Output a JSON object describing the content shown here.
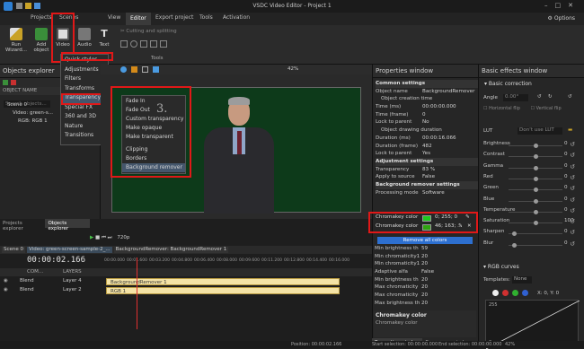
{
  "window_title": "VSDC Video Editor - Project 1",
  "menu": [
    "Projects",
    "Scenes",
    "View",
    "Editor",
    "Export project",
    "Tools",
    "Activation"
  ],
  "options_label": "Options",
  "ribbon": {
    "buttons": [
      "Run Wizard...",
      "Add object",
      "Video",
      "Audio",
      "Text"
    ],
    "cutting": "Cutting and splitting",
    "tools_label": "Tools"
  },
  "objects_explorer": {
    "title": "Objects explorer",
    "object_name_col": "OBJECT NAME",
    "search_placeholder": "Search objects...",
    "tree": [
      "Scene 0",
      "Video: green-s...",
      "RGB: RGB 1"
    ]
  },
  "video_menu": [
    "Quick styles",
    "Adjustments",
    "Filters",
    "Transforms",
    "Transparency",
    "Special FX",
    "360 and 3D",
    "Nature",
    "Transitions"
  ],
  "transparency_menu": [
    "Fade In",
    "Fade Out",
    "Custom transparency",
    "Make opaque",
    "Make transparent",
    "Clipping",
    "Borders",
    "Background remover"
  ],
  "step_label": "3.",
  "preview_zoom": "42%",
  "properties": {
    "title": "Properties window",
    "rows": [
      {
        "type": "section",
        "label": "Common settings"
      },
      {
        "label": "Object name",
        "value": "BackgroundRemover"
      },
      {
        "type": "sub",
        "label": "Object creation time"
      },
      {
        "label": "Time (ms)",
        "value": "00:00:00.000"
      },
      {
        "label": "Time (frame)",
        "value": "0"
      },
      {
        "label": "Lock to parent",
        "value": "No"
      },
      {
        "type": "sub",
        "label": "Object drawing duration"
      },
      {
        "label": "Duration (ms)",
        "value": "00:00:16.066"
      },
      {
        "label": "Duration (frame)",
        "value": "482"
      },
      {
        "label": "Lock to parent",
        "value": "Yes"
      },
      {
        "type": "section",
        "label": "Adjustment settings"
      },
      {
        "label": "Transparency",
        "value": "83 %"
      },
      {
        "label": "Apply to source",
        "value": "False"
      },
      {
        "type": "section",
        "label": "Background remover settings"
      },
      {
        "label": "Processing mode",
        "value": "Software"
      }
    ],
    "chromakey1": {
      "label": "Chromakey color",
      "value": "0; 255; 0"
    },
    "chromakey2": {
      "label": "Chromakey color",
      "value": "46; 163; ..."
    },
    "remove_all": "Remove all colors",
    "rows2": [
      {
        "label": "Min brightness th",
        "value": "59"
      },
      {
        "label": "Min chromaticity1",
        "value": "20"
      },
      {
        "label": "Min chromaticity1",
        "value": "20"
      },
      {
        "label": "Adaptive alfa",
        "value": "False"
      },
      {
        "label": "Min brightness th",
        "value": "20"
      },
      {
        "label": "Max chromaticity",
        "value": "20"
      },
      {
        "label": "Max chromaticity",
        "value": "20"
      },
      {
        "label": "Max brightness th",
        "value": "20"
      }
    ],
    "footer_title": "Chromakey color",
    "footer_desc": "Chromakey color",
    "tabs": [
      "Properties window",
      "Resources window"
    ]
  },
  "basic_effects": {
    "title": "Basic effects window",
    "section": "Basic correction",
    "angle_label": "Angle",
    "angle_value": "0.00°",
    "hflip": "Horizontal flip",
    "vflip": "Vertical flip",
    "lut_label": "LUT",
    "lut_value": "Don't use LUT",
    "rows": [
      {
        "label": "Brightness",
        "value": "0",
        "pos": 0.5
      },
      {
        "label": "Contrast",
        "value": "0",
        "pos": 0.5
      },
      {
        "label": "Gamma",
        "value": "0",
        "pos": 0.5
      },
      {
        "label": "Red",
        "value": "0",
        "pos": 0.5
      },
      {
        "label": "Green",
        "value": "0",
        "pos": 0.5
      },
      {
        "label": "Blue",
        "value": "0",
        "pos": 0.5
      },
      {
        "label": "Temperature",
        "value": "0",
        "pos": 0.5
      },
      {
        "label": "Saturation",
        "value": "100",
        "pos": 0.5
      },
      {
        "label": "Sharpen",
        "value": "0",
        "pos": 0.1
      },
      {
        "label": "Blur",
        "value": "0",
        "pos": 0.1
      }
    ],
    "rgb_curves": "RGB curves",
    "templates_label": "Templates:",
    "templates_value": "None",
    "curve_coords": "X: 0, Y: 0",
    "curve_max": "255",
    "curve_min": "0"
  },
  "timeline": {
    "tabs": [
      "Projects explorer",
      "Objects explorer"
    ],
    "zoom": "720p",
    "breadcrumb": [
      "Scene 0",
      "Video: green-screen-sample-2_...",
      "BackgroundRemover: BackgroundRemover 1"
    ],
    "time": "00:00:02.166",
    "com_label": "COM...",
    "layers_label": "LAYERS",
    "ticks": [
      "00:00.000",
      "00:01.600",
      "00:03.200",
      "00:04.800",
      "00:06.400",
      "00:08.000",
      "00:09.600",
      "00:11.200",
      "00:12.800",
      "00:14.400",
      "00:16.000"
    ],
    "tracks": [
      {
        "blend": "Blend",
        "layer": "Layer 4",
        "clip": "BackgroundRemover 1"
      },
      {
        "blend": "Blend",
        "layer": "Layer 2",
        "clip": "RGB 1"
      }
    ],
    "position_label": "Position:",
    "position_value": "00:00:02.166",
    "start_sel_label": "Start selection:",
    "start_sel_value": "00:00:00.000",
    "end_sel_label": "End selection:",
    "end_sel_value": "00:00:00.000",
    "zoom_percent": "42%"
  },
  "colors": {
    "accent": "#e01818",
    "green": "#1ec81e",
    "clip": "#f4e3a6",
    "chroma2": "#2ea310"
  }
}
